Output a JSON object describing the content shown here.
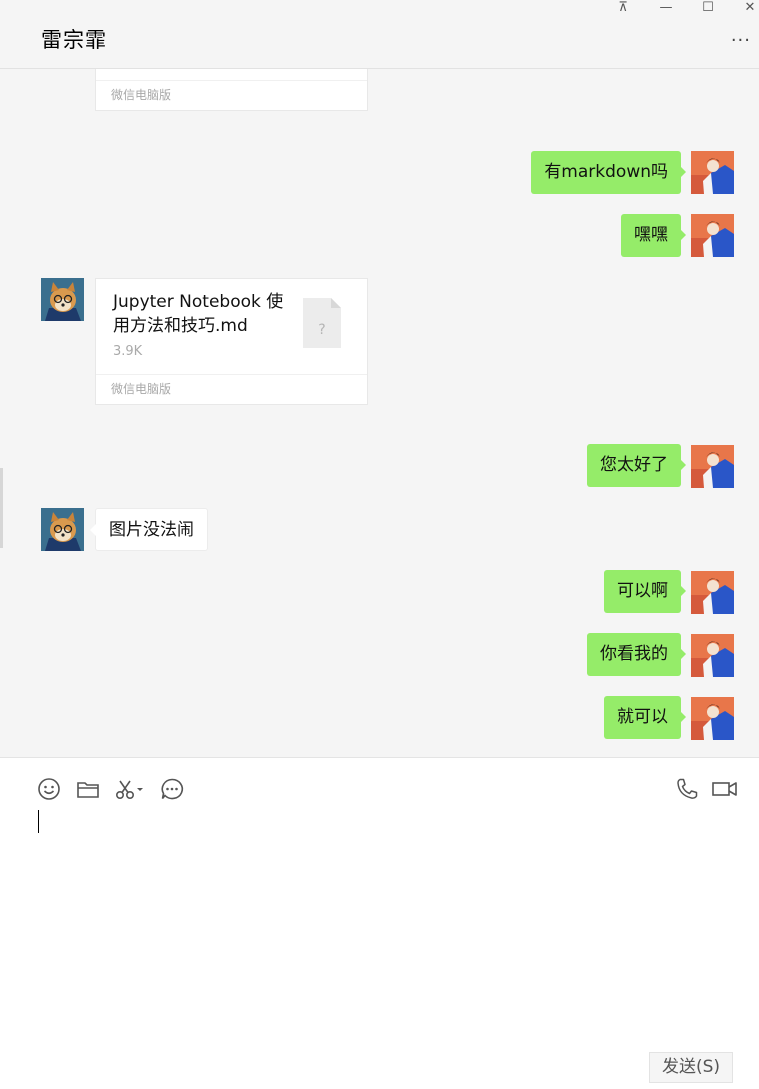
{
  "window": {
    "pin_glyph": "⊼",
    "minimize_glyph": "—",
    "maximize_glyph": "☐",
    "close_glyph": "✕"
  },
  "header": {
    "title": "雷宗霏",
    "more_glyph": "···"
  },
  "messages": {
    "file1": {
      "footer": "微信电脑版"
    },
    "m1": {
      "text": "有markdown吗"
    },
    "m2": {
      "text": "嘿嘿"
    },
    "file2": {
      "name": "Jupyter Notebook 使用方法和技巧.md",
      "size": "3.9K",
      "footer": "微信电脑版",
      "icon_glyph": "?"
    },
    "m3": {
      "text": "您太好了"
    },
    "m4": {
      "text": "图片没法闹"
    },
    "m5": {
      "text": "可以啊"
    },
    "m6": {
      "text": "你看我的"
    },
    "m7": {
      "text": "就可以"
    }
  },
  "toolbar": {
    "icons": [
      "emoji-icon",
      "folder-icon",
      "scissors-icon",
      "chat-bubble-icon",
      "phone-icon",
      "video-icon"
    ]
  },
  "input": {
    "value": ""
  },
  "send": {
    "label": "发送(S)"
  },
  "colors": {
    "my_bubble": "#95ec69",
    "other_bubble": "#ffffff",
    "background": "#f5f5f5"
  }
}
